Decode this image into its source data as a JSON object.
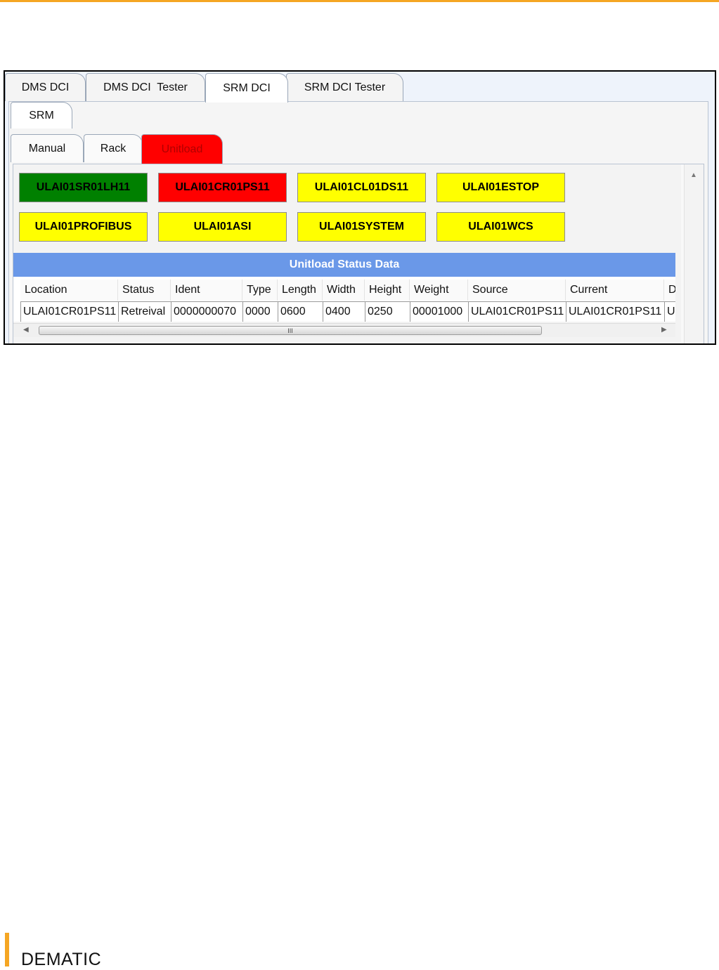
{
  "main_tabs": [
    "DMS DCI",
    "DMS DCI  Tester",
    "SRM DCI",
    "SRM DCI Tester"
  ],
  "sub_tab": "SRM",
  "inner_tabs": [
    "Manual",
    "Rack",
    "Unitload"
  ],
  "status_buttons": [
    {
      "label": "ULAI01SR01LH11",
      "color": "#008000"
    },
    {
      "label": "ULAI01CR01PS11",
      "color": "#ff0000"
    },
    {
      "label": "ULAI01CL01DS11",
      "color": "#ffff00"
    },
    {
      "label": "ULAI01ESTOP",
      "color": "#ffff00"
    },
    {
      "label": "ULAI01PROFIBUS",
      "color": "#ffff00"
    },
    {
      "label": "ULAI01ASI",
      "color": "#ffff00"
    },
    {
      "label": "ULAI01SYSTEM",
      "color": "#ffff00"
    },
    {
      "label": "ULAI01WCS",
      "color": "#ffff00"
    }
  ],
  "grid": {
    "title": "Unitload Status Data",
    "columns": [
      "Location",
      "Status",
      "Ident",
      "Type",
      "Length",
      "Width",
      "Height",
      "Weight",
      "Source",
      "Current",
      "D"
    ],
    "row": [
      "ULAI01CR01PS11",
      "Retreival",
      "0000000070",
      "0000",
      "0600",
      "0400",
      "0250",
      "00001000",
      "ULAI01CR01PS11",
      "ULAI01CR01PS11",
      "U"
    ]
  },
  "scroll_thumb_glyph": "III",
  "footer": {
    "brand": "DEMATIC"
  },
  "colors": {
    "accent": "#f5a623",
    "grid_title_bg": "#6a98e8",
    "active_tab": "#ff0000"
  }
}
